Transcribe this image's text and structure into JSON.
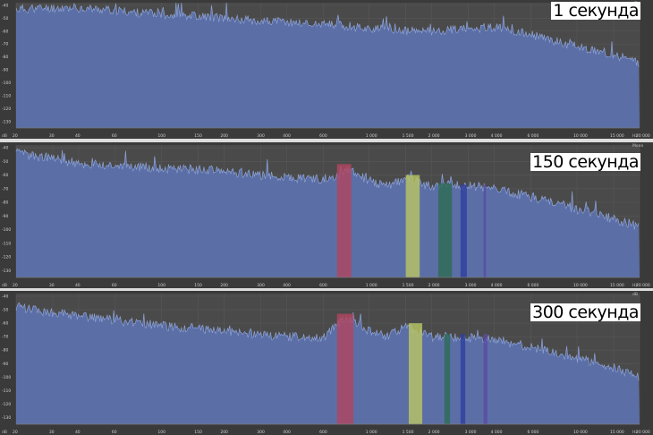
{
  "chart_data": [
    {
      "type": "area",
      "title": "1 секунда",
      "xscale": "log",
      "x_ticks": [
        "20",
        "30",
        "40",
        "60",
        "100",
        "150",
        "200",
        "300",
        "400",
        "600",
        "1 000",
        "1 500",
        "2 000",
        "3 000",
        "4 000",
        "6 000",
        "10 000",
        "15 000",
        "20 000"
      ],
      "y_ticks": [
        "-40",
        "-50",
        "-60",
        "-70",
        "-80",
        "-90",
        "-100",
        "-110",
        "-120",
        "-130"
      ],
      "corner_label_top": "dB",
      "corner_label_bottom": "dB",
      "axis_unit": "Hz",
      "ylim": [
        -135,
        -38
      ],
      "fill_color": "#5b6fa6",
      "line_color": "#8ea3d8",
      "envelope": [
        [
          20,
          -43
        ],
        [
          30,
          -42
        ],
        [
          40,
          -42
        ],
        [
          60,
          -44
        ],
        [
          80,
          -46
        ],
        [
          100,
          -47
        ],
        [
          150,
          -48
        ],
        [
          200,
          -50
        ],
        [
          300,
          -52
        ],
        [
          400,
          -53
        ],
        [
          600,
          -55
        ],
        [
          800,
          -56
        ],
        [
          1000,
          -58
        ],
        [
          1500,
          -60
        ],
        [
          2000,
          -60
        ],
        [
          3000,
          -58
        ],
        [
          4000,
          -57
        ],
        [
          6000,
          -63
        ],
        [
          10000,
          -72
        ],
        [
          15000,
          -78
        ],
        [
          20000,
          -85
        ]
      ],
      "bands": []
    },
    {
      "type": "area",
      "title": "150 секунда",
      "xscale": "log",
      "x_ticks": [
        "20",
        "30",
        "40",
        "60",
        "100",
        "150",
        "200",
        "300",
        "400",
        "600",
        "1 000",
        "1 500",
        "2 000",
        "3 000",
        "4 000",
        "6 000",
        "10 000",
        "15 000",
        "20 000"
      ],
      "y_ticks": [
        "-40",
        "-50",
        "-60",
        "-70",
        "-80",
        "-90",
        "-100",
        "-110",
        "-120",
        "-130"
      ],
      "corner_label_top": "Mono",
      "corner_label_bottom": "dB",
      "axis_unit": "Hz",
      "ylim": [
        -135,
        -38
      ],
      "fill_color": "#5b6fa6",
      "line_color": "#8ea3d8",
      "envelope": [
        [
          20,
          -44
        ],
        [
          30,
          -48
        ],
        [
          40,
          -52
        ],
        [
          60,
          -53
        ],
        [
          80,
          -54
        ],
        [
          100,
          -55
        ],
        [
          150,
          -56
        ],
        [
          200,
          -57
        ],
        [
          300,
          -60
        ],
        [
          400,
          -62
        ],
        [
          600,
          -63
        ],
        [
          700,
          -60
        ],
        [
          800,
          -56
        ],
        [
          1000,
          -64
        ],
        [
          1200,
          -68
        ],
        [
          1500,
          -62
        ],
        [
          1700,
          -65
        ],
        [
          2000,
          -69
        ],
        [
          2500,
          -67
        ],
        [
          3000,
          -68
        ],
        [
          4000,
          -70
        ],
        [
          6000,
          -76
        ],
        [
          10000,
          -85
        ],
        [
          15000,
          -92
        ],
        [
          20000,
          -98
        ]
      ],
      "bands": [
        {
          "from": 700,
          "to": 820,
          "top": -52,
          "color": "#b04560"
        },
        {
          "from": 1500,
          "to": 1750,
          "top": -60,
          "color": "#b8c564"
        },
        {
          "from": 2150,
          "to": 2500,
          "top": -66,
          "color": "#2f6b55"
        },
        {
          "from": 2750,
          "to": 2950,
          "top": -67,
          "color": "#2f3fa0"
        },
        {
          "from": 3550,
          "to": 3650,
          "top": -67,
          "color": "#5a4aa5"
        }
      ]
    },
    {
      "type": "area",
      "title": "300 секунда",
      "xscale": "log",
      "x_ticks": [
        "20",
        "30",
        "40",
        "60",
        "100",
        "150",
        "200",
        "300",
        "400",
        "600",
        "1 000",
        "1 500",
        "2 000",
        "3 000",
        "4 000",
        "6 000",
        "10 000",
        "15 000",
        "20 000"
      ],
      "y_ticks": [
        "-40",
        "-50",
        "-60",
        "-70",
        "-80",
        "-90",
        "-100",
        "-110",
        "-120",
        "-130"
      ],
      "corner_label_top": "dB",
      "corner_label_bottom": "dB",
      "axis_unit": "Hz",
      "ylim": [
        -135,
        -38
      ],
      "fill_color": "#5b6fa6",
      "line_color": "#8ea3d8",
      "envelope": [
        [
          20,
          -48
        ],
        [
          30,
          -52
        ],
        [
          40,
          -55
        ],
        [
          60,
          -58
        ],
        [
          80,
          -60
        ],
        [
          100,
          -62
        ],
        [
          150,
          -64
        ],
        [
          200,
          -66
        ],
        [
          300,
          -68
        ],
        [
          400,
          -70
        ],
        [
          600,
          -71
        ],
        [
          700,
          -60
        ],
        [
          800,
          -56
        ],
        [
          1000,
          -66
        ],
        [
          1200,
          -70
        ],
        [
          1500,
          -63
        ],
        [
          1700,
          -66
        ],
        [
          2000,
          -70
        ],
        [
          2500,
          -70
        ],
        [
          3000,
          -71
        ],
        [
          4000,
          -72
        ],
        [
          6000,
          -78
        ],
        [
          10000,
          -86
        ],
        [
          15000,
          -93
        ],
        [
          20000,
          -100
        ]
      ],
      "bands": [
        {
          "from": 700,
          "to": 840,
          "top": -53,
          "color": "#b04560"
        },
        {
          "from": 1550,
          "to": 1800,
          "top": -60,
          "color": "#b8c564"
        },
        {
          "from": 2300,
          "to": 2450,
          "top": -68,
          "color": "#2f6b55"
        },
        {
          "from": 2750,
          "to": 2900,
          "top": -68,
          "color": "#2f3fa0"
        },
        {
          "from": 3550,
          "to": 3700,
          "top": -68,
          "color": "#5a4aa5"
        }
      ]
    }
  ]
}
